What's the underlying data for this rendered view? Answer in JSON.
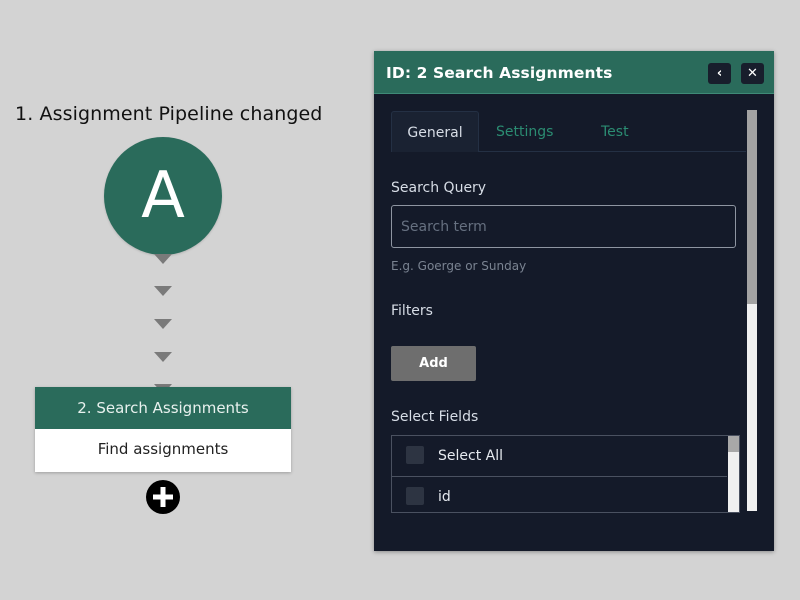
{
  "pipeline": {
    "trigger_title": "1. Assignment Pipeline changed",
    "trigger_letter": "A",
    "step": {
      "title": "2. Search Assignments",
      "subtitle": "Find assignments"
    },
    "add_step_icon": "plus-circle-icon"
  },
  "panel": {
    "title": "ID: 2  Search Assignments",
    "back_icon": "chevron-left-icon",
    "close_icon": "close-icon",
    "back_label": "‹",
    "close_label": "✕",
    "tabs": [
      {
        "label": "General",
        "active": true
      },
      {
        "label": "Settings",
        "active": false
      },
      {
        "label": "Test",
        "active": false
      }
    ],
    "search": {
      "label": "Search Query",
      "value": "",
      "placeholder": "Search term",
      "hint": "E.g. Goerge or Sunday"
    },
    "filters": {
      "label": "Filters",
      "add_label": "Add"
    },
    "select_fields": {
      "label": "Select Fields",
      "items": [
        {
          "label": "Select All",
          "checked": false
        },
        {
          "label": "id",
          "checked": false
        }
      ]
    }
  },
  "colors": {
    "accent": "#2a6b5b",
    "panel_bg": "#141a29",
    "canvas_bg": "#d3d3d3",
    "tab_inactive": "#2b8c72"
  }
}
